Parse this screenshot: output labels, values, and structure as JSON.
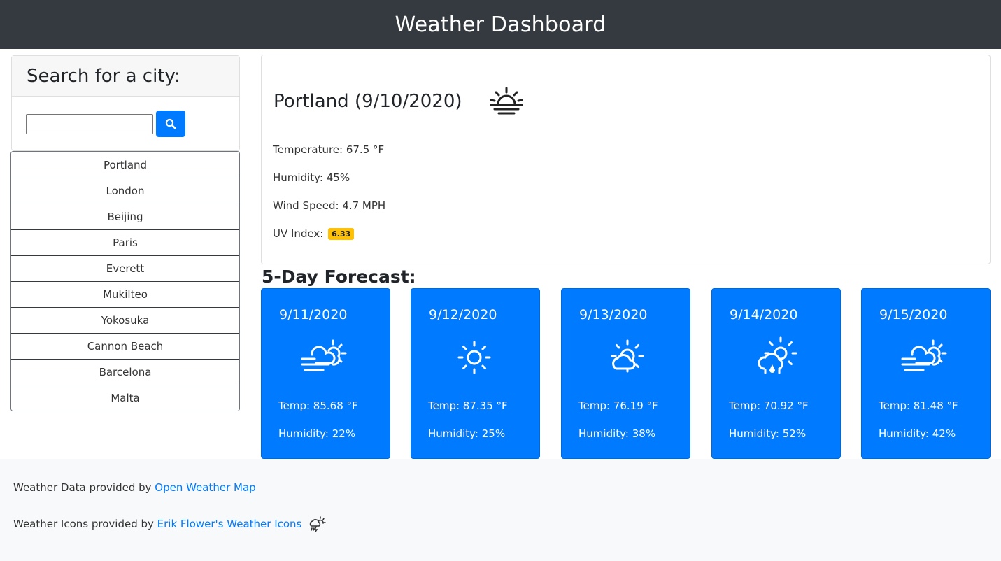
{
  "header": {
    "title": "Weather Dashboard"
  },
  "search": {
    "heading": "Search for a city:",
    "input_value": "",
    "button_icon": "search-icon"
  },
  "cities": [
    "Portland",
    "London",
    "Beijing",
    "Paris",
    "Everett",
    "Mukilteo",
    "Yokosuka",
    "Cannon Beach",
    "Barcelona",
    "Malta"
  ],
  "current": {
    "title": "Portland (9/10/2020)",
    "icon": "sunrise-icon",
    "temperature": "Temperature: 67.5 °F",
    "humidity": "Humidity: 45%",
    "wind": "Wind Speed: 4.7 MPH",
    "uv_label": "UV Index:",
    "uv_value": "6.33",
    "uv_color": "#ffc107"
  },
  "forecast": {
    "heading": "5-Day Forecast:",
    "days": [
      {
        "date": "9/11/2020",
        "icon": "day-windy-cloud-icon",
        "temp": "Temp: 85.68 °F",
        "humidity": "Humidity: 22%"
      },
      {
        "date": "9/12/2020",
        "icon": "day-sunny-icon",
        "temp": "Temp: 87.35 °F",
        "humidity": "Humidity: 25%"
      },
      {
        "date": "9/13/2020",
        "icon": "day-cloudy-icon",
        "temp": "Temp: 76.19 °F",
        "humidity": "Humidity: 38%"
      },
      {
        "date": "9/14/2020",
        "icon": "day-rain-icon",
        "temp": "Temp: 70.92 °F",
        "humidity": "Humidity: 52%"
      },
      {
        "date": "9/15/2020",
        "icon": "day-windy-cloud-icon",
        "temp": "Temp: 81.48 °F",
        "humidity": "Humidity: 42%"
      }
    ]
  },
  "footer": {
    "data_prefix": "Weather Data provided by ",
    "data_link": "Open Weather Map",
    "icons_prefix": "Weather Icons provided by ",
    "icons_link": "Erik Flower's Weather Icons",
    "icon": "day-storm-icon"
  },
  "colors": {
    "navbar": "#343a40",
    "primary": "#007bff",
    "uv_moderate": "#ffc107"
  }
}
